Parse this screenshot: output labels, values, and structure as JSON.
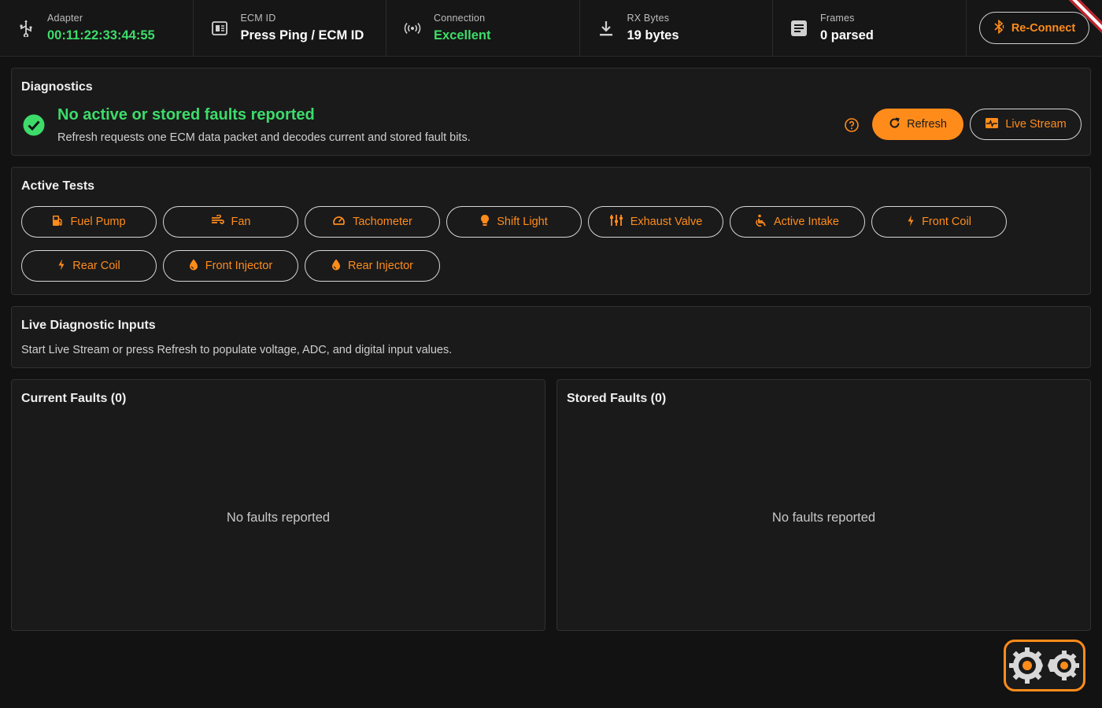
{
  "topbar": {
    "adapter": {
      "label": "Adapter",
      "value": "00:11:22:33:44:55",
      "icon": "usb-icon"
    },
    "ecm": {
      "label": "ECM ID",
      "value": "Press Ping / ECM ID",
      "icon": "chip-icon"
    },
    "connection": {
      "label": "Connection",
      "value": "Excellent",
      "icon": "signal-icon"
    },
    "rx": {
      "label": "RX Bytes",
      "value": "19 bytes",
      "icon": "download-icon"
    },
    "frames": {
      "label": "Frames",
      "value": "0 parsed",
      "icon": "document-icon"
    },
    "reconnect_label": "Re-Connect"
  },
  "diagnostics": {
    "title": "Diagnostics",
    "status": "No active or stored faults reported",
    "subtitle": "Refresh requests one ECM data packet and decodes current and stored fault bits.",
    "refresh_label": "Refresh",
    "live_stream_label": "Live Stream"
  },
  "active_tests": {
    "title": "Active Tests",
    "tests": [
      {
        "label": "Fuel Pump",
        "icon": "fuel-pump-icon"
      },
      {
        "label": "Fan",
        "icon": "fan-icon"
      },
      {
        "label": "Tachometer",
        "icon": "gauge-icon"
      },
      {
        "label": "Shift Light",
        "icon": "bulb-icon"
      },
      {
        "label": "Exhaust Valve",
        "icon": "valve-icon"
      },
      {
        "label": "Active Intake",
        "icon": "intake-icon"
      },
      {
        "label": "Front Coil",
        "icon": "bolt-icon"
      },
      {
        "label": "Rear Coil",
        "icon": "bolt-icon"
      },
      {
        "label": "Front Injector",
        "icon": "drop-icon"
      },
      {
        "label": "Rear Injector",
        "icon": "drop-icon"
      }
    ]
  },
  "live_inputs": {
    "title": "Live Diagnostic Inputs",
    "text": "Start Live Stream or press Refresh to populate voltage, ADC, and digital input values."
  },
  "current_faults": {
    "title": "Current Faults (0)",
    "empty": "No faults reported"
  },
  "stored_faults": {
    "title": "Stored Faults (0)",
    "empty": "No faults reported"
  },
  "colors": {
    "accent": "#ff8c1a",
    "success": "#3ddc6a",
    "background": "#121212"
  }
}
